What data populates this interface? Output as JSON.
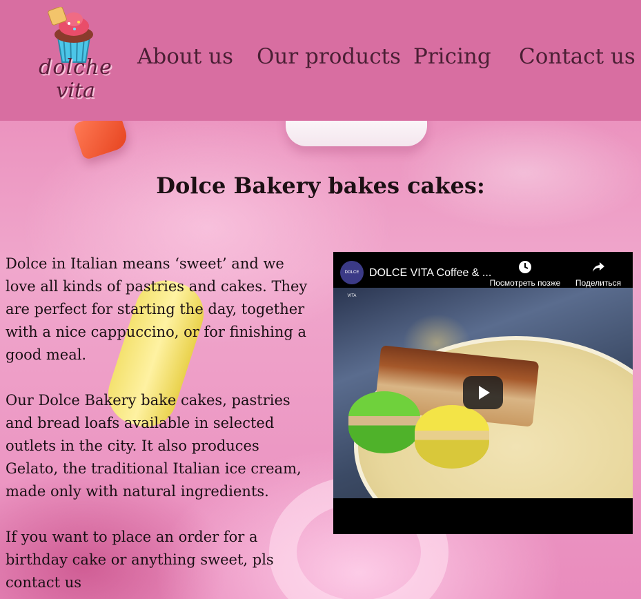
{
  "logo": {
    "line1": "dolche",
    "line2": "vita"
  },
  "nav": {
    "items": [
      {
        "label": "About us"
      },
      {
        "label": "Our products"
      },
      {
        "label": "Pricing"
      },
      {
        "label": "Contact us"
      }
    ]
  },
  "page": {
    "title": "Dolce Bakery bakes cakes:"
  },
  "intro": {
    "paragraphs": [
      "Dolce in Italian means ‘sweet’ and we love all kinds of pastries and cakes. They are perfect for starting the day, together with a nice cappuccino, or for finishing a good meal.",
      "Our Dolce Bakery bake cakes, pastries and bread loafs available in selected outlets in the city. It also produces Gelato, the traditional Italian ice cream, made only with natural ingredients.",
      "If you want to place an order for a birthday cake or anything sweet, pls contact us"
    ]
  },
  "video": {
    "title": "DOLCE VITA Coffee & ...",
    "watch_later": "Посмотреть позже",
    "share": "Поделиться",
    "channel_initials": "DOLCE VITA"
  },
  "colors": {
    "header_bg": "#d86ea1",
    "nav_text": "#4a1f34",
    "body_text": "#1a1015"
  },
  "icons": [
    "cupcake-logo-icon",
    "clock-icon",
    "share-icon",
    "play-icon"
  ]
}
